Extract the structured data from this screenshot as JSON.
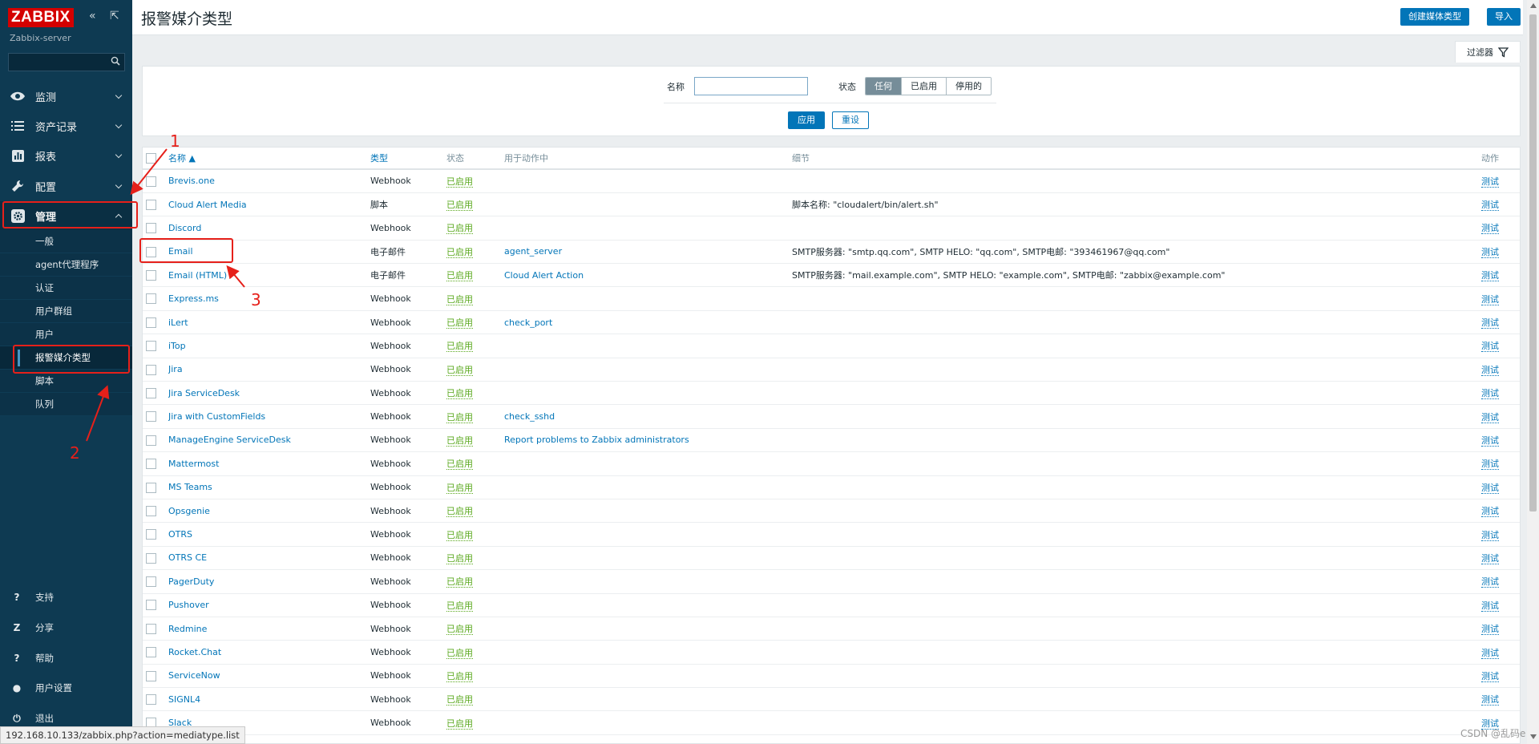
{
  "app": {
    "logo": "ZABBIX",
    "server": "Zabbix-server",
    "collapse_glyph": "«",
    "kiosk_glyph": "⇱"
  },
  "sidebar": {
    "menu": [
      {
        "label": "监测",
        "icon": "eye-icon"
      },
      {
        "label": "资产记录",
        "icon": "list-icon"
      },
      {
        "label": "报表",
        "icon": "bar-chart-icon"
      },
      {
        "label": "配置",
        "icon": "wrench-icon"
      },
      {
        "label": "管理",
        "icon": "gear-icon"
      }
    ],
    "submenu": [
      "一般",
      "agent代理程序",
      "认证",
      "用户群组",
      "用户",
      "报警媒介类型",
      "脚本",
      "队列"
    ],
    "bottom": [
      {
        "label": "支持",
        "glyph": "?"
      },
      {
        "label": "分享",
        "glyph": "Z"
      },
      {
        "label": "帮助",
        "glyph": "?"
      },
      {
        "label": "用户设置",
        "glyph": "●"
      },
      {
        "label": "退出",
        "glyph": "⏻"
      }
    ]
  },
  "header": {
    "title": "报警媒介类型",
    "create_button": "创建媒体类型",
    "import_button": "导入"
  },
  "filter": {
    "tab_label": "过滤器",
    "name_label": "名称",
    "name_value": "",
    "status_label": "状态",
    "status_options": [
      "任何",
      "已启用",
      "停用的"
    ],
    "status_selected": "任何",
    "apply": "应用",
    "reset": "重设"
  },
  "table": {
    "columns": [
      "名称 ▲",
      "类型",
      "状态",
      "用于动作中",
      "细节",
      "动作"
    ],
    "rows": [
      {
        "name": "Brevis.one",
        "type": "Webhook",
        "status": "已启用",
        "action": "",
        "details": "",
        "op": "测试"
      },
      {
        "name": "Cloud Alert Media",
        "type": "脚本",
        "status": "已启用",
        "action": "",
        "details": "脚本名称: \"cloudalert/bin/alert.sh\"",
        "op": "测试"
      },
      {
        "name": "Discord",
        "type": "Webhook",
        "status": "已启用",
        "action": "",
        "details": "",
        "op": "测试"
      },
      {
        "name": "Email",
        "type": "电子邮件",
        "status": "已启用",
        "action": "agent_server",
        "details": "SMTP服务器: \"smtp.qq.com\", SMTP HELO: \"qq.com\", SMTP电邮: \"393461967@qq.com\"",
        "op": "测试"
      },
      {
        "name": "Email (HTML)",
        "type": "电子邮件",
        "status": "已启用",
        "action": "Cloud Alert Action",
        "details": "SMTP服务器: \"mail.example.com\", SMTP HELO: \"example.com\", SMTP电邮: \"zabbix@example.com\"",
        "op": "测试"
      },
      {
        "name": "Express.ms",
        "type": "Webhook",
        "status": "已启用",
        "action": "",
        "details": "",
        "op": "测试"
      },
      {
        "name": "iLert",
        "type": "Webhook",
        "status": "已启用",
        "action": "check_port",
        "details": "",
        "op": "测试"
      },
      {
        "name": "iTop",
        "type": "Webhook",
        "status": "已启用",
        "action": "",
        "details": "",
        "op": "测试"
      },
      {
        "name": "Jira",
        "type": "Webhook",
        "status": "已启用",
        "action": "",
        "details": "",
        "op": "测试"
      },
      {
        "name": "Jira ServiceDesk",
        "type": "Webhook",
        "status": "已启用",
        "action": "",
        "details": "",
        "op": "测试"
      },
      {
        "name": "Jira with CustomFields",
        "type": "Webhook",
        "status": "已启用",
        "action": "check_sshd",
        "details": "",
        "op": "测试"
      },
      {
        "name": "ManageEngine ServiceDesk",
        "type": "Webhook",
        "status": "已启用",
        "action": "Report problems to Zabbix administrators",
        "details": "",
        "op": "测试"
      },
      {
        "name": "Mattermost",
        "type": "Webhook",
        "status": "已启用",
        "action": "",
        "details": "",
        "op": "测试"
      },
      {
        "name": "MS Teams",
        "type": "Webhook",
        "status": "已启用",
        "action": "",
        "details": "",
        "op": "测试"
      },
      {
        "name": "Opsgenie",
        "type": "Webhook",
        "status": "已启用",
        "action": "",
        "details": "",
        "op": "测试"
      },
      {
        "name": "OTRS",
        "type": "Webhook",
        "status": "已启用",
        "action": "",
        "details": "",
        "op": "测试"
      },
      {
        "name": "OTRS CE",
        "type": "Webhook",
        "status": "已启用",
        "action": "",
        "details": "",
        "op": "测试"
      },
      {
        "name": "PagerDuty",
        "type": "Webhook",
        "status": "已启用",
        "action": "",
        "details": "",
        "op": "测试"
      },
      {
        "name": "Pushover",
        "type": "Webhook",
        "status": "已启用",
        "action": "",
        "details": "",
        "op": "测试"
      },
      {
        "name": "Redmine",
        "type": "Webhook",
        "status": "已启用",
        "action": "",
        "details": "",
        "op": "测试"
      },
      {
        "name": "Rocket.Chat",
        "type": "Webhook",
        "status": "已启用",
        "action": "",
        "details": "",
        "op": "测试"
      },
      {
        "name": "ServiceNow",
        "type": "Webhook",
        "status": "已启用",
        "action": "",
        "details": "",
        "op": "测试"
      },
      {
        "name": "SIGNL4",
        "type": "Webhook",
        "status": "已启用",
        "action": "",
        "details": "",
        "op": "测试"
      },
      {
        "name": "Slack",
        "type": "Webhook",
        "status": "已启用",
        "action": "",
        "details": "",
        "op": "测试"
      }
    ]
  },
  "annotations": [
    "1",
    "2",
    "3"
  ],
  "statusbar": {
    "url": "192.168.10.133/zabbix.php?action=mediatype.list",
    "watermark": "CSDN @乱码e"
  },
  "colors": {
    "sidebar": "#0e3a52",
    "accent": "#0275b8",
    "enabled": "#59a81c",
    "annotation": "#e6201a"
  }
}
